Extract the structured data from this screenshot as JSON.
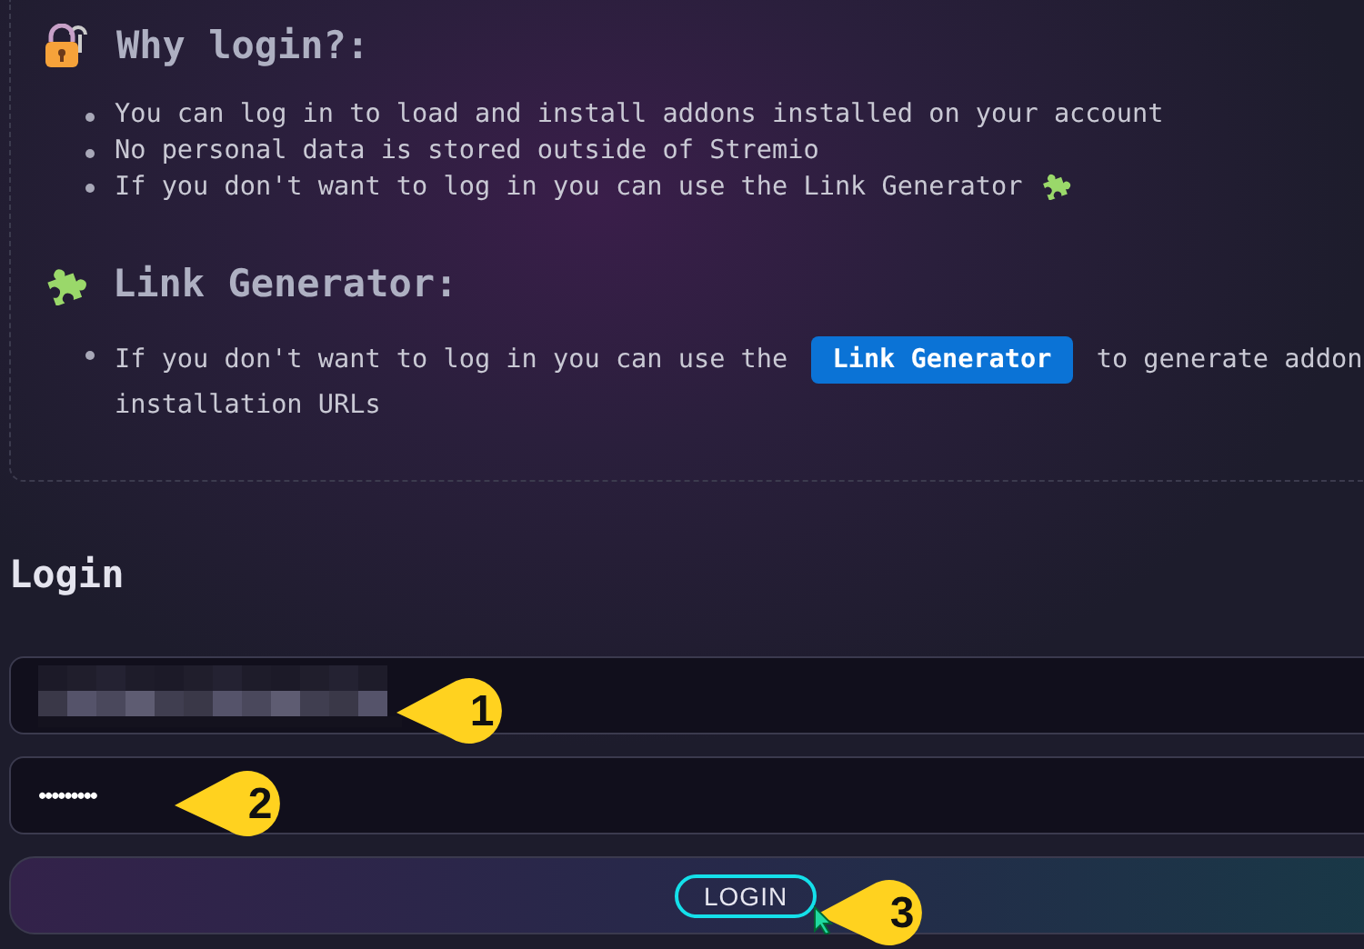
{
  "why_login": {
    "heading": "Why login?:",
    "bullets": [
      "You can log in to load and install addons installed on your account",
      "No personal data is stored outside of Stremio",
      "If you don't want to log in you can use the Link Generator"
    ]
  },
  "link_generator": {
    "heading": "Link Generator:",
    "text_before": "If you don't want to log in you can use the",
    "link": "Link Generator",
    "text_after": "to generate addon installation URLs"
  },
  "login": {
    "heading": "Login",
    "email_field": {
      "kind": "redacted"
    },
    "password_field": {
      "value": "•••••••••"
    },
    "button": "LOGIN"
  },
  "annotations": [
    {
      "label": "1"
    },
    {
      "label": "2"
    },
    {
      "label": "3"
    }
  ]
}
